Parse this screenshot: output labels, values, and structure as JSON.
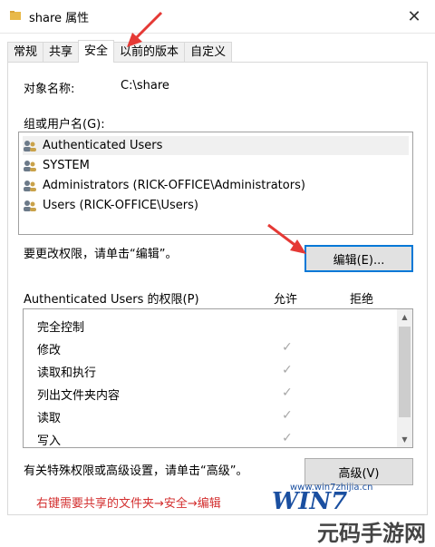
{
  "window": {
    "title": "share 属性",
    "close_glyph": "✕"
  },
  "tabs": [
    {
      "label": "常规",
      "active": false
    },
    {
      "label": "共享",
      "active": false
    },
    {
      "label": "安全",
      "active": true
    },
    {
      "label": "以前的版本",
      "active": false
    },
    {
      "label": "自定义",
      "active": false
    }
  ],
  "object": {
    "label": "对象名称:",
    "value": "C:\\share"
  },
  "groups": {
    "label": "组或用户名(G):",
    "items": [
      "Authenticated Users",
      "SYSTEM",
      "Administrators (RICK-OFFICE\\Administrators)",
      "Users (RICK-OFFICE\\Users)"
    ],
    "selected_index": 0
  },
  "edit": {
    "hint": "要更改权限，请单击“编辑”。",
    "button": "编辑(E)..."
  },
  "permissions": {
    "title": "Authenticated Users 的权限(P)",
    "allow_header": "允许",
    "deny_header": "拒绝",
    "rows": [
      {
        "name": "完全控制",
        "allow": false
      },
      {
        "name": "修改",
        "allow": true
      },
      {
        "name": "读取和执行",
        "allow": true
      },
      {
        "name": "列出文件夹内容",
        "allow": true
      },
      {
        "name": "读取",
        "allow": true
      },
      {
        "name": "写入",
        "allow": true
      }
    ],
    "check_glyph": "✓"
  },
  "advanced": {
    "hint": "有关特殊权限或高级设置，请单击“高级”。",
    "button": "高级(V)"
  },
  "annotation": {
    "text": "右键需要共享的文件夹→安全→编辑"
  },
  "watermark": {
    "logo": "WIN7",
    "url": "www.win7zhijia.cn",
    "site": "元码手游网"
  },
  "colors": {
    "accent": "#0078d7",
    "annotation": "#d32f2f",
    "arrow": "#e53935"
  }
}
